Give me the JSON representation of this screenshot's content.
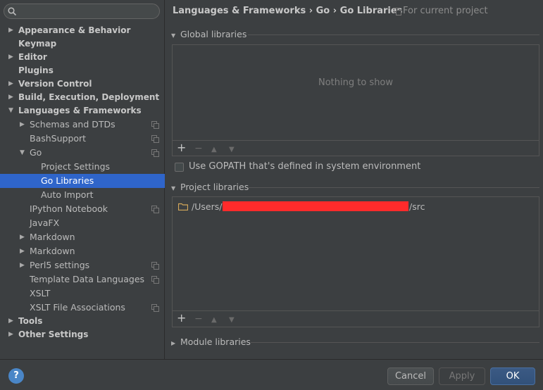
{
  "search": {
    "value": "",
    "placeholder": ""
  },
  "tree": [
    {
      "label": "Appearance & Behavior",
      "arrow": "▶",
      "bold": true
    },
    {
      "label": "Keymap",
      "arrow": "",
      "bold": true
    },
    {
      "label": "Editor",
      "arrow": "▶",
      "bold": true
    },
    {
      "label": "Plugins",
      "arrow": "",
      "bold": true
    },
    {
      "label": "Version Control",
      "arrow": "▶",
      "bold": true
    },
    {
      "label": "Build, Execution, Deployment",
      "arrow": "▶",
      "bold": true
    },
    {
      "label": "Languages & Frameworks",
      "arrow": "▼",
      "bold": true
    },
    {
      "label": "Schemas and DTDs",
      "arrow": "▶",
      "project": true
    },
    {
      "label": "BashSupport",
      "arrow": "",
      "project": true
    },
    {
      "label": "Go",
      "arrow": "▼",
      "project": true
    },
    {
      "label": "Project Settings",
      "arrow": ""
    },
    {
      "label": "Go Libraries",
      "arrow": "",
      "selected": true
    },
    {
      "label": "Auto Import",
      "arrow": ""
    },
    {
      "label": "IPython Notebook",
      "arrow": "",
      "project": true
    },
    {
      "label": "JavaFX",
      "arrow": ""
    },
    {
      "label": "Markdown",
      "arrow": "▶"
    },
    {
      "label": "Markdown",
      "arrow": "▶"
    },
    {
      "label": "Perl5 settings",
      "arrow": "▶",
      "project": true
    },
    {
      "label": "Template Data Languages",
      "arrow": "",
      "project": true
    },
    {
      "label": "XSLT",
      "arrow": ""
    },
    {
      "label": "XSLT File Associations",
      "arrow": "",
      "project": true
    },
    {
      "label": "Tools",
      "arrow": "▶",
      "bold": true
    },
    {
      "label": "Other Settings",
      "arrow": "▶",
      "bold": true
    }
  ],
  "header": {
    "breadcrumb": "Languages & Frameworks › Go › Go Libraries",
    "scope": "For current project"
  },
  "global_libraries": {
    "title": "Global libraries",
    "arrow": "▼",
    "empty_text": "Nothing to show"
  },
  "gopath_checkbox": {
    "label": "Use GOPATH that's defined in system environment",
    "checked": false
  },
  "project_libraries": {
    "title": "Project libraries",
    "arrow": "▼",
    "item_prefix": "/Users/",
    "item_suffix": "/src"
  },
  "module_libraries": {
    "title": "Module libraries",
    "arrow": "▶"
  },
  "toolbar": {
    "add": "+",
    "remove": "−",
    "up": "▲",
    "down": "▼"
  },
  "buttons": {
    "help": "?",
    "cancel": "Cancel",
    "apply": "Apply",
    "ok": "OK"
  },
  "colors": {
    "selection": "#2f65ca",
    "redaction": "#ff2b2b",
    "ok_button": "#365880"
  }
}
